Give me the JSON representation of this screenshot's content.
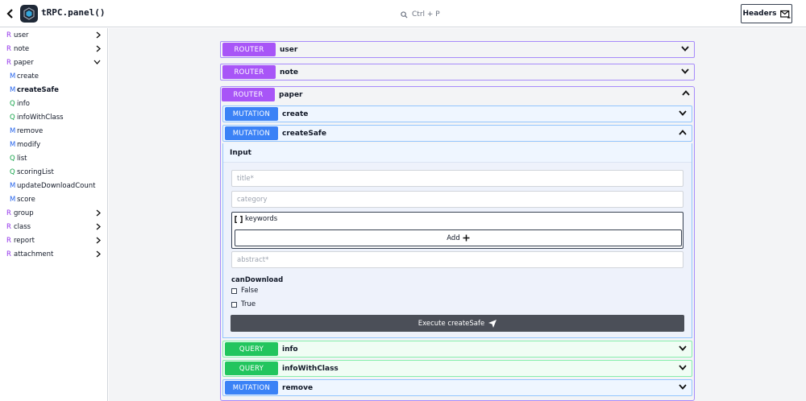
{
  "header": {
    "title": "tRPC.panel()",
    "search_label": "Ctrl + P",
    "headers_button": "Headers"
  },
  "sidebar": {
    "items": [
      {
        "letter": "R",
        "label": "user",
        "kind": "router"
      },
      {
        "letter": "R",
        "label": "note",
        "kind": "router"
      },
      {
        "letter": "R",
        "label": "paper",
        "kind": "router",
        "expanded": true
      },
      {
        "letter": "M",
        "label": "create",
        "kind": "mutation"
      },
      {
        "letter": "M",
        "label": "createSafe",
        "kind": "mutation",
        "active": true
      },
      {
        "letter": "Q",
        "label": "info",
        "kind": "query"
      },
      {
        "letter": "Q",
        "label": "infoWithClass",
        "kind": "query"
      },
      {
        "letter": "M",
        "label": "remove",
        "kind": "mutation"
      },
      {
        "letter": "M",
        "label": "modify",
        "kind": "mutation"
      },
      {
        "letter": "Q",
        "label": "list",
        "kind": "query"
      },
      {
        "letter": "Q",
        "label": "scoringList",
        "kind": "query"
      },
      {
        "letter": "M",
        "label": "updateDownloadCount",
        "kind": "mutation"
      },
      {
        "letter": "M",
        "label": "score",
        "kind": "mutation"
      },
      {
        "letter": "R",
        "label": "group",
        "kind": "router"
      },
      {
        "letter": "R",
        "label": "class",
        "kind": "router"
      },
      {
        "letter": "R",
        "label": "report",
        "kind": "router"
      },
      {
        "letter": "R",
        "label": "attachment",
        "kind": "router"
      }
    ]
  },
  "main": {
    "routers": [
      {
        "badge": "ROUTER",
        "name": "user"
      },
      {
        "badge": "ROUTER",
        "name": "note"
      },
      {
        "badge": "ROUTER",
        "name": "paper"
      }
    ],
    "procedures": [
      {
        "badge": "MUTATION",
        "name": "create"
      },
      {
        "badge": "MUTATION",
        "name": "createSafe"
      },
      {
        "badge": "QUERY",
        "name": "info"
      },
      {
        "badge": "QUERY",
        "name": "infoWithClass"
      },
      {
        "badge": "MUTATION",
        "name": "remove"
      }
    ],
    "form": {
      "input_title": "Input",
      "title_placeholder": "title*",
      "category_placeholder": "category",
      "array_label": "keywords",
      "add_label": "Add",
      "abstract_placeholder": "abstract*",
      "checkbox_title": "canDownload",
      "false_label": "False",
      "true_label": "True",
      "execute_label": "Execute createSafe"
    }
  },
  "colors": {
    "router": "#a855f7",
    "mutation": "#3b82f6",
    "query": "#22c55e",
    "execute": "#4b4f58"
  }
}
